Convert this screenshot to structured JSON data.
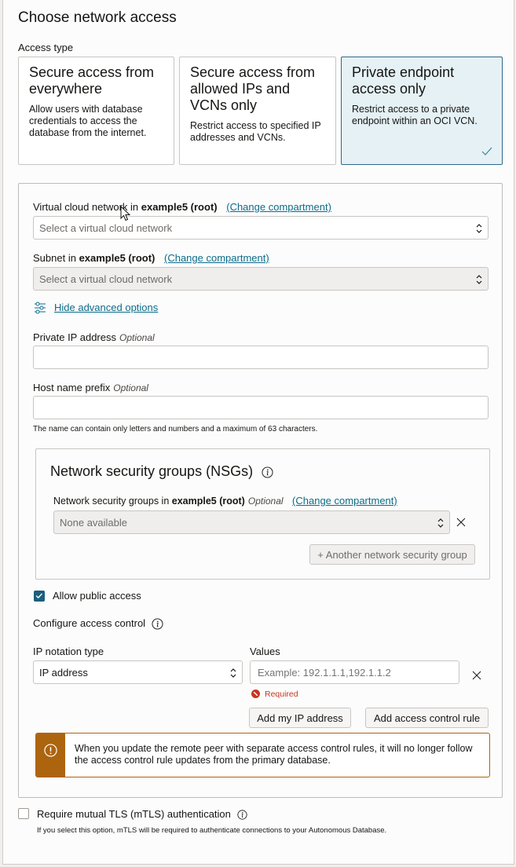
{
  "page": {
    "title": "Choose network access",
    "access_type_label": "Access type"
  },
  "access_cards": [
    {
      "title": "Secure access from everywhere",
      "description": "Allow users with database credentials to access the database from the internet.",
      "selected": false
    },
    {
      "title": "Secure access from allowed IPs and VCNs only",
      "description": "Restrict access to specified IP addresses and VCNs.",
      "selected": false
    },
    {
      "title": "Private endpoint access only",
      "description": "Restrict access to a private endpoint within an OCI VCN.",
      "selected": true
    }
  ],
  "vcn": {
    "label_prefix": "Virtual cloud network in",
    "compartment": "example5 (root)",
    "change_link": "(Change compartment)",
    "placeholder": "Select a virtual cloud network"
  },
  "subnet": {
    "label_prefix": "Subnet in",
    "compartment": "example5 (root)",
    "change_link": "(Change compartment)",
    "placeholder": "Select a virtual cloud network"
  },
  "advanced_link": "Hide advanced options",
  "private_ip": {
    "label": "Private IP address",
    "optional": "Optional",
    "value": ""
  },
  "host_prefix": {
    "label": "Host name prefix",
    "optional": "Optional",
    "value": "",
    "help": "The name can contain only letters and numbers and a maximum of 63 characters."
  },
  "nsg": {
    "title": "Network security groups (NSGs)",
    "label_prefix": "Network security groups in",
    "compartment": "example5 (root)",
    "optional": "Optional",
    "change_link": "(Change compartment)",
    "value": "None available",
    "add_button": "+ Another network security group"
  },
  "public_access": {
    "label": "Allow public access",
    "checked": true
  },
  "access_control": {
    "label": "Configure access control",
    "ip_notation_label": "IP notation type",
    "ip_notation_value": "IP address",
    "values_label": "Values",
    "values_placeholder": "Example: 192.1.1.1,192.1.1.2",
    "error": "Required",
    "add_my_ip_button": "Add my IP address",
    "add_rule_button": "Add access control rule"
  },
  "warning": {
    "text": "When you update the remote peer with separate access control rules, it will no longer follow the access control rule updates from the primary database."
  },
  "mtls": {
    "label": "Require mutual TLS (mTLS) authentication",
    "checked": false,
    "help": "If you select this option, mTLS will be required to authenticate connections to your Autonomous Database."
  },
  "colors": {
    "accent": "#0b6c8a",
    "selected_bg": "#e5f1f5",
    "warning": "#ad640e",
    "error": "#c7361f",
    "checkbox": "#1b5f7d"
  }
}
